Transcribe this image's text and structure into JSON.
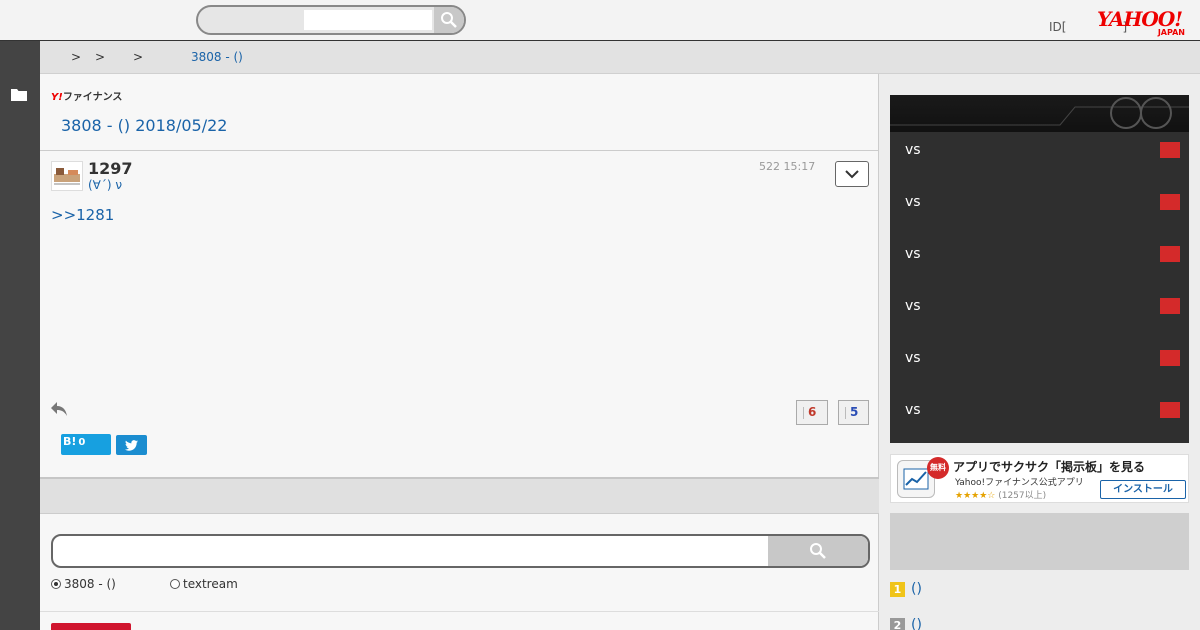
{
  "header": {
    "search_placeholder": "",
    "id_text": "ID[",
    "id_suffix": "]",
    "logo_text": "YAHOO!",
    "logo_sub": "JAPAN"
  },
  "breadcrumb": {
    "separators": [
      ">",
      ">",
      ">"
    ],
    "current": "3808 - ()"
  },
  "main": {
    "finance_logo_y": "Y!",
    "finance_logo_text": "ファイナンス",
    "thread_title": "3808 - () 2018/05/22",
    "post": {
      "number": "1297",
      "author": "(∀´) ν",
      "time": "522 15:17",
      "body": ">>1281",
      "likes": "6",
      "dislikes": "5"
    },
    "share": {
      "hatena_label": "B!",
      "hatena_count": "0"
    },
    "search": {
      "placeholder": "",
      "option_1": "3808 - ()",
      "option_2": "textream",
      "selected": "option_1"
    }
  },
  "sidebar": {
    "scores": [
      {
        "label": "vs"
      },
      {
        "label": "vs"
      },
      {
        "label": "vs"
      },
      {
        "label": "vs"
      },
      {
        "label": "vs"
      },
      {
        "label": "vs"
      }
    ],
    "app_ad": {
      "badge": "無料",
      "title": "アプリでサクサク「掲示板」を見る",
      "subtitle": "Yahoo!ファイナンス公式アプリ",
      "stars": "★★★★☆",
      "reviews": "(1257以上)",
      "install": "インストール"
    },
    "ranking": [
      {
        "rank": "1",
        "label": "()",
        "color": "#f0c419"
      },
      {
        "rank": "2",
        "label": "()",
        "color": "#999999"
      }
    ]
  },
  "colors": {
    "link": "#1a63a8",
    "accent_red": "#d42a2a",
    "yahoo_red": "#e00000"
  }
}
